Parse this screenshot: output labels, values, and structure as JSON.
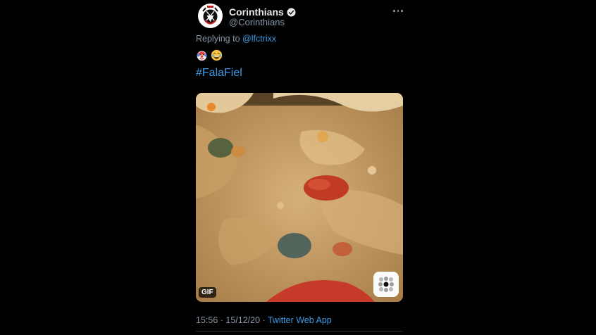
{
  "tweet": {
    "display_name": "Corinthians",
    "handle": "@Corinthians",
    "replying_prefix": "Replying to",
    "replying_to": "@lfctrixx",
    "emoji_1": "clown-face",
    "emoji_2": "face-with-tears-of-joy",
    "hashtag": "#FalaFiel",
    "time": "15:56",
    "sep1": " · ",
    "date": "15/12/20",
    "sep2": " · ",
    "source": "Twitter Web App"
  },
  "media": {
    "badge": "GIF"
  },
  "colors": {
    "background": "#000000",
    "link": "#3b9be8",
    "muted": "#8b98a5",
    "text": "#e7e9ea",
    "bread": "#c8a06a"
  },
  "icons": {
    "avatar": "corinthians-crest-icon",
    "verified": "verified-badge-icon",
    "more": "more-options-icon",
    "media_app": "grid-app-icon"
  }
}
